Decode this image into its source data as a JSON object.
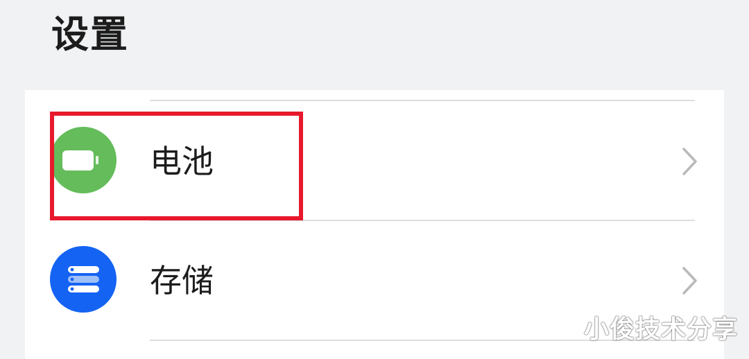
{
  "page": {
    "title": "设置"
  },
  "settings_items": [
    {
      "label": "电池",
      "icon": "battery-icon",
      "icon_color": "#64bc5b",
      "highlighted": true
    },
    {
      "label": "存储",
      "icon": "storage-icon",
      "icon_color": "#1463f3",
      "highlighted": false
    }
  ],
  "annotation": {
    "highlight_color": "#e8192c"
  },
  "watermark": {
    "text": "小俊技术分享"
  }
}
